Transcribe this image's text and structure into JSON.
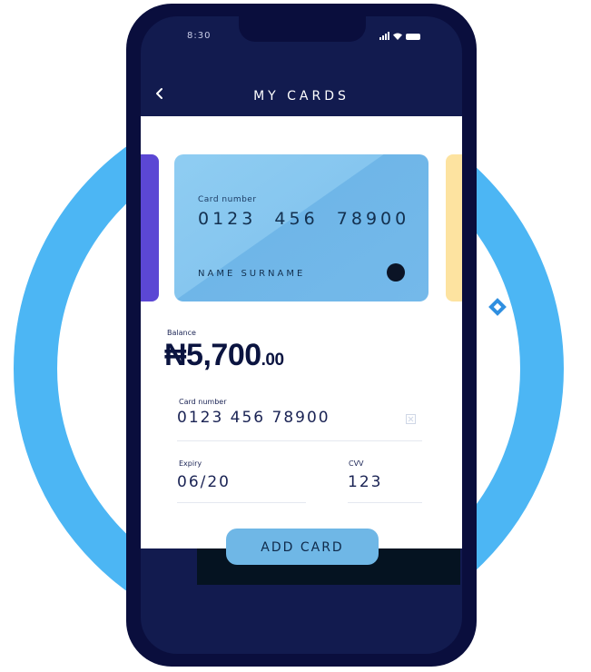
{
  "status_bar": {
    "time": "8:30"
  },
  "header": {
    "title": "MY CARDS"
  },
  "card": {
    "number_label": "Card number",
    "number": "0123  456  78900",
    "holder": "NAME SURNAME"
  },
  "balance": {
    "label": "Balance",
    "amount": "₦5,700",
    "cents": ".00"
  },
  "form": {
    "card_number_label": "Card number",
    "card_number_value": "0123 456 78900",
    "expiry_label": "Expiry",
    "expiry_value": "06/20",
    "cvv_label": "CVV",
    "cvv_value": "123"
  },
  "actions": {
    "add_card_label": "ADD CARD"
  },
  "colors": {
    "ring": "#4cb6f4",
    "phone_body": "#0a0e3d",
    "card_primary": "#86c6ef",
    "card_left": "#5b47d4",
    "card_right": "#fde3a0",
    "button": "#6fb7e6"
  }
}
